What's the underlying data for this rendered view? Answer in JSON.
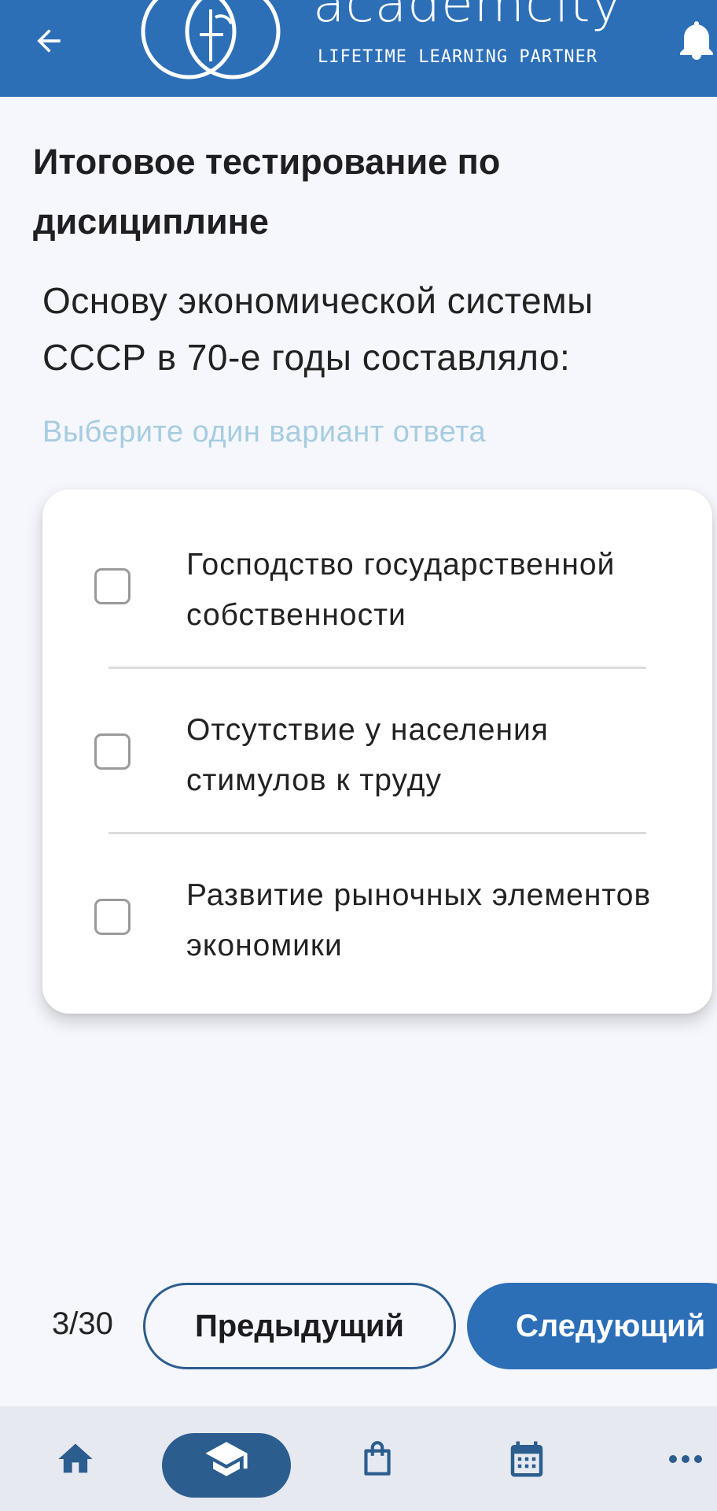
{
  "header": {
    "brand_name": "academcity",
    "tagline": "LIFETIME LEARNING PARTNER",
    "colors": {
      "bar": "#2c6fb7",
      "icon": "#ffffff"
    },
    "icons": {
      "back": "arrow-left-icon",
      "bell": "bell-icon"
    }
  },
  "page": {
    "title": "Итоговое тестирование по дисициплине"
  },
  "question": {
    "text": "Основу экономической системы СССР в 70-е годы составляло:",
    "hint": "Выберите один вариант ответа",
    "options": [
      {
        "label": "Господство государственной собственности",
        "checked": false
      },
      {
        "label": "Отсутствие у населения стимулов к труду",
        "checked": false
      },
      {
        "label": "Развитие рыночных элементов экономики",
        "checked": false
      }
    ]
  },
  "pagination": {
    "counter": "3/30",
    "prev_label": "Предыдущий",
    "next_label": "Следующий"
  },
  "bottom_nav": {
    "items": [
      {
        "icon": "home-icon",
        "active": false
      },
      {
        "icon": "graduation-cap-icon",
        "active": true
      },
      {
        "icon": "shopping-bag-icon",
        "active": false
      },
      {
        "icon": "calendar-icon",
        "active": false
      },
      {
        "icon": "more-dots-icon",
        "active": false
      }
    ],
    "colors": {
      "background": "#e6e9f0",
      "icon": "#2c5d8f",
      "active_pill": "#2c5d8f",
      "active_icon": "#ffffff"
    }
  }
}
